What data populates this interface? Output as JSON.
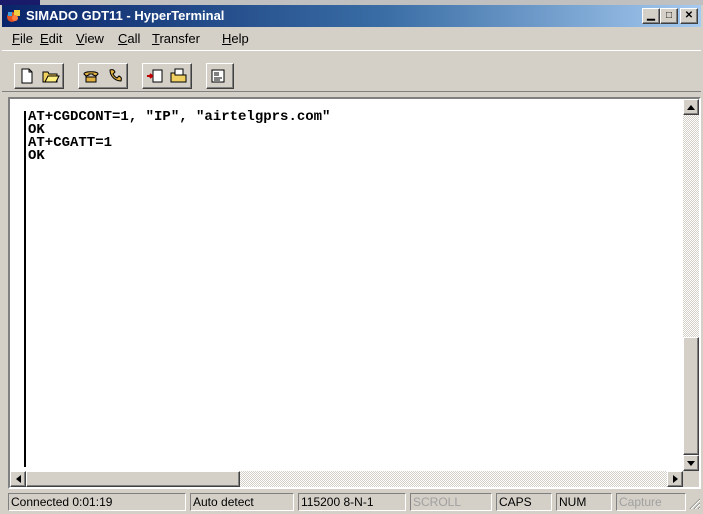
{
  "window": {
    "title": "SIMADO GDT11 - HyperTerminal",
    "controls": [
      "minimize",
      "maximize",
      "close"
    ]
  },
  "menu": [
    {
      "label": "File",
      "mnemonic": "F"
    },
    {
      "label": "Edit",
      "mnemonic": "E"
    },
    {
      "label": "View",
      "mnemonic": "V"
    },
    {
      "label": "Call",
      "mnemonic": "C"
    },
    {
      "label": "Transfer",
      "mnemonic": "T"
    },
    {
      "label": "Help",
      "mnemonic": "H"
    }
  ],
  "toolbar": {
    "buttons": [
      {
        "icon": "new-document-icon"
      },
      {
        "icon": "open-folder-icon"
      },
      {
        "icon": "call-phone-icon"
      },
      {
        "icon": "disconnect-phone-icon"
      },
      {
        "icon": "send-file-icon"
      },
      {
        "icon": "receive-file-icon"
      },
      {
        "icon": "properties-icon"
      }
    ]
  },
  "terminal": {
    "lines": [
      "AT+CGDCONT=1, \"IP\", \"airtelgprs.com\"",
      "OK",
      "AT+CGATT=1",
      "OK"
    ]
  },
  "status": {
    "connected": "Connected 0:01:19",
    "detect": "Auto detect",
    "settings": "115200 8-N-1",
    "scroll": "SCROLL",
    "caps": "CAPS",
    "num": "NUM",
    "capture": "Capture"
  },
  "colors": {
    "title_start": "#0a246a",
    "title_end": "#a6caf0",
    "face": "#d4d0c8"
  }
}
